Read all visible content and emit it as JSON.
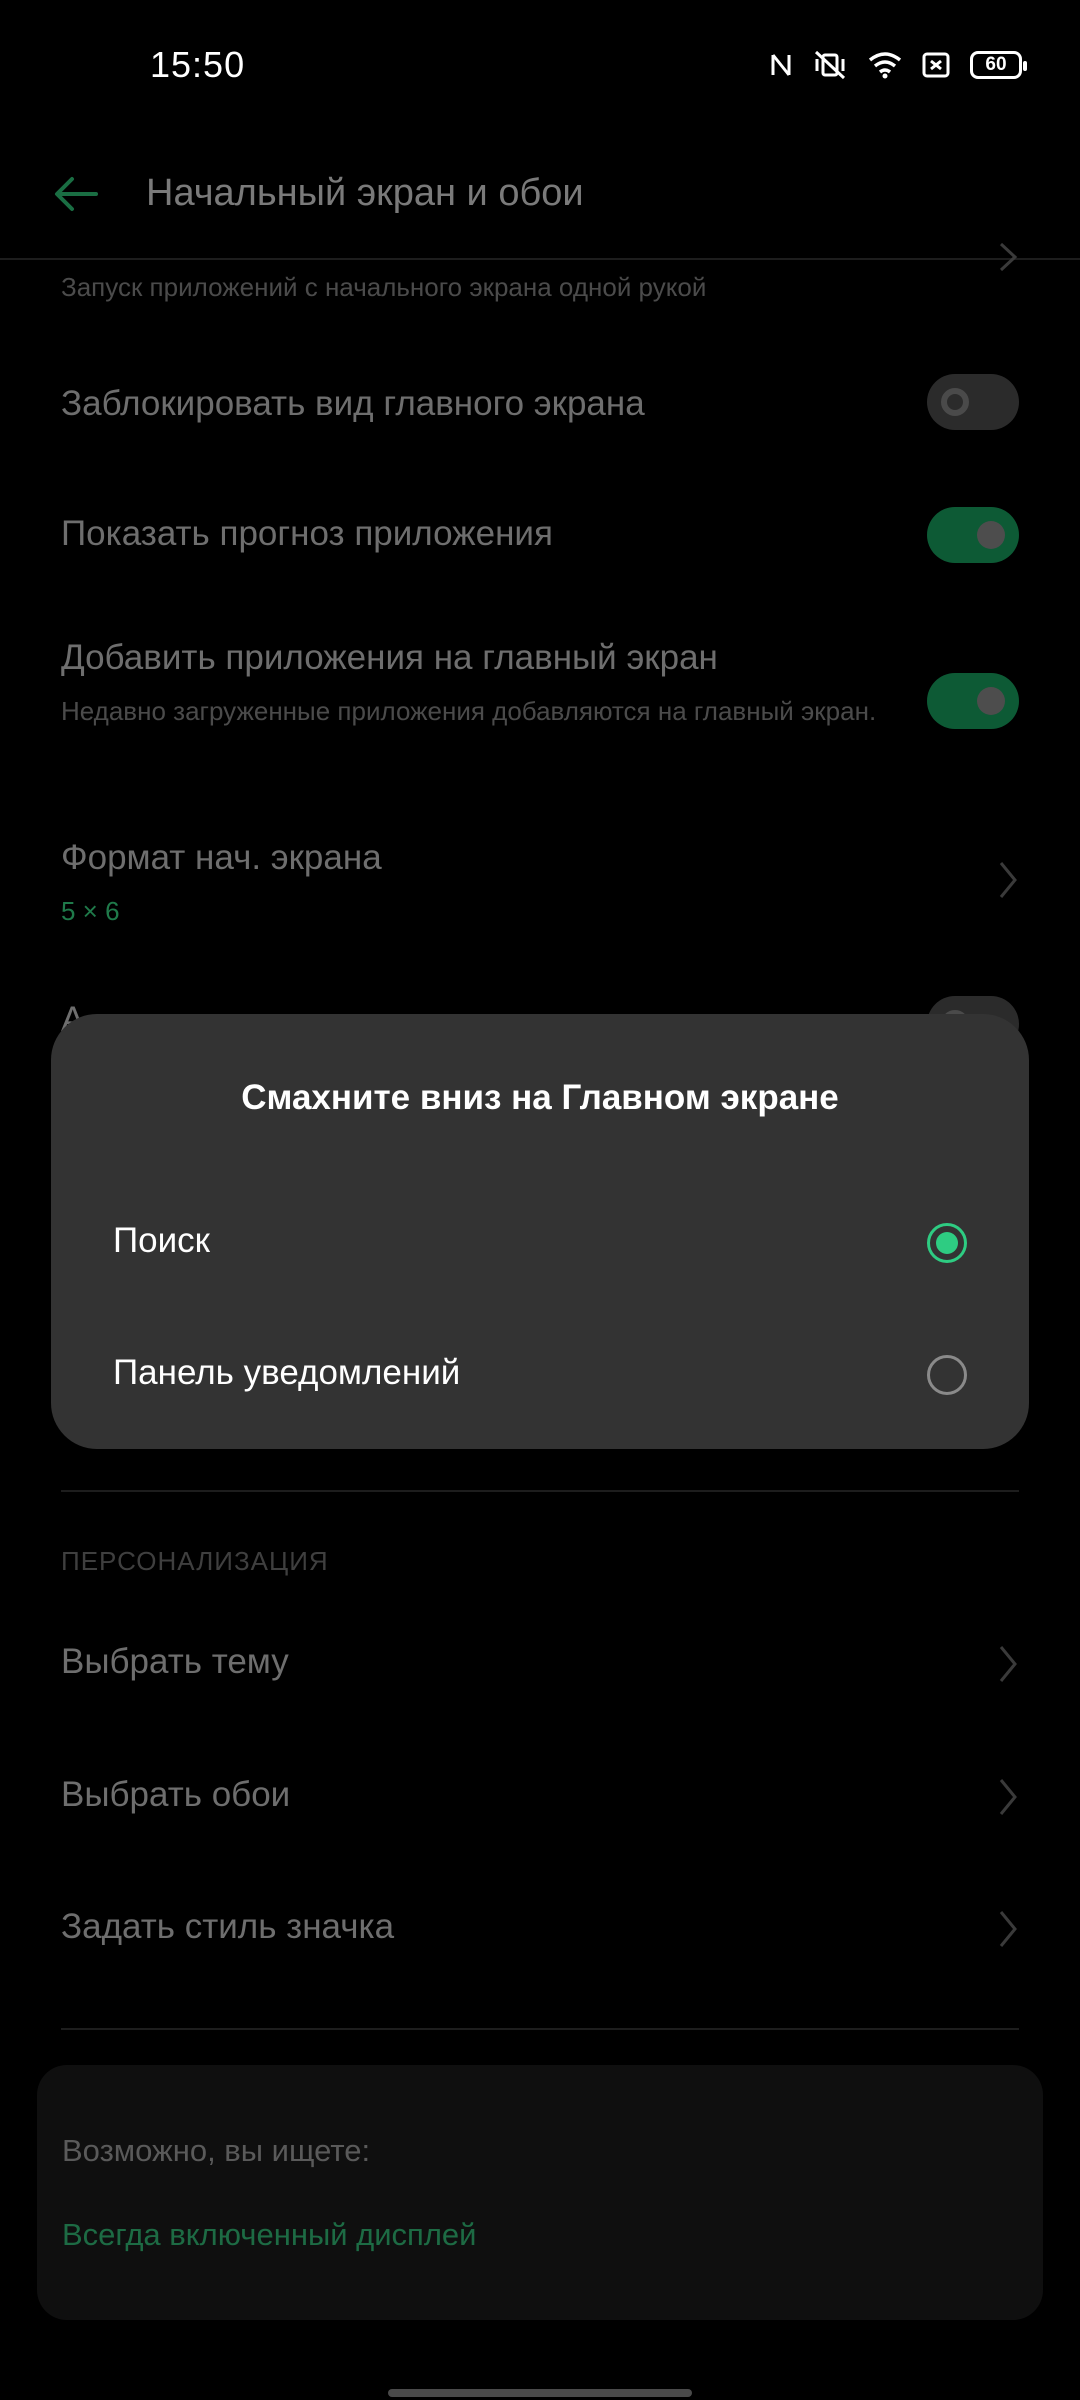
{
  "status_bar": {
    "time": "15:50",
    "battery": "60",
    "icons": [
      "nfc-icon",
      "vibrate-off-icon",
      "wifi-icon",
      "sim-icon",
      "battery-icon"
    ]
  },
  "app_bar": {
    "title": "Начальный экран и обои",
    "back_icon": "arrow-left-icon"
  },
  "settings": {
    "one_hand_subtitle": "Запуск приложений с начального экрана одной рукой",
    "lock_layout": {
      "title": "Заблокировать вид главного экрана",
      "enabled": false
    },
    "app_suggestions": {
      "title": "Показать прогноз приложения",
      "enabled": true
    },
    "add_apps": {
      "title": "Добавить приложения на главный экран",
      "subtitle": "Недавно загруженные приложения добавляются на главный экран.",
      "enabled": true
    },
    "grid_format": {
      "title": "Формат нач. экрана",
      "value": "5 × 6"
    },
    "hidden_row_initial": "А"
  },
  "personalization": {
    "section_label": "ПЕРСОНАЛИЗАЦИЯ",
    "items": [
      {
        "label": "Выбрать тему"
      },
      {
        "label": "Выбрать обои"
      },
      {
        "label": "Задать стиль значка"
      }
    ]
  },
  "suggestions": {
    "title": "Возможно, вы ищете:",
    "link": "Всегда включенный дисплей"
  },
  "dialog": {
    "title": "Смахните вниз на Главном экране",
    "options": [
      {
        "label": "Поиск",
        "selected": true
      },
      {
        "label": "Панель уведомлений",
        "selected": false
      }
    ]
  },
  "colors": {
    "accent": "#2ecc82",
    "dialog_bg": "#333333",
    "background": "#000000"
  }
}
